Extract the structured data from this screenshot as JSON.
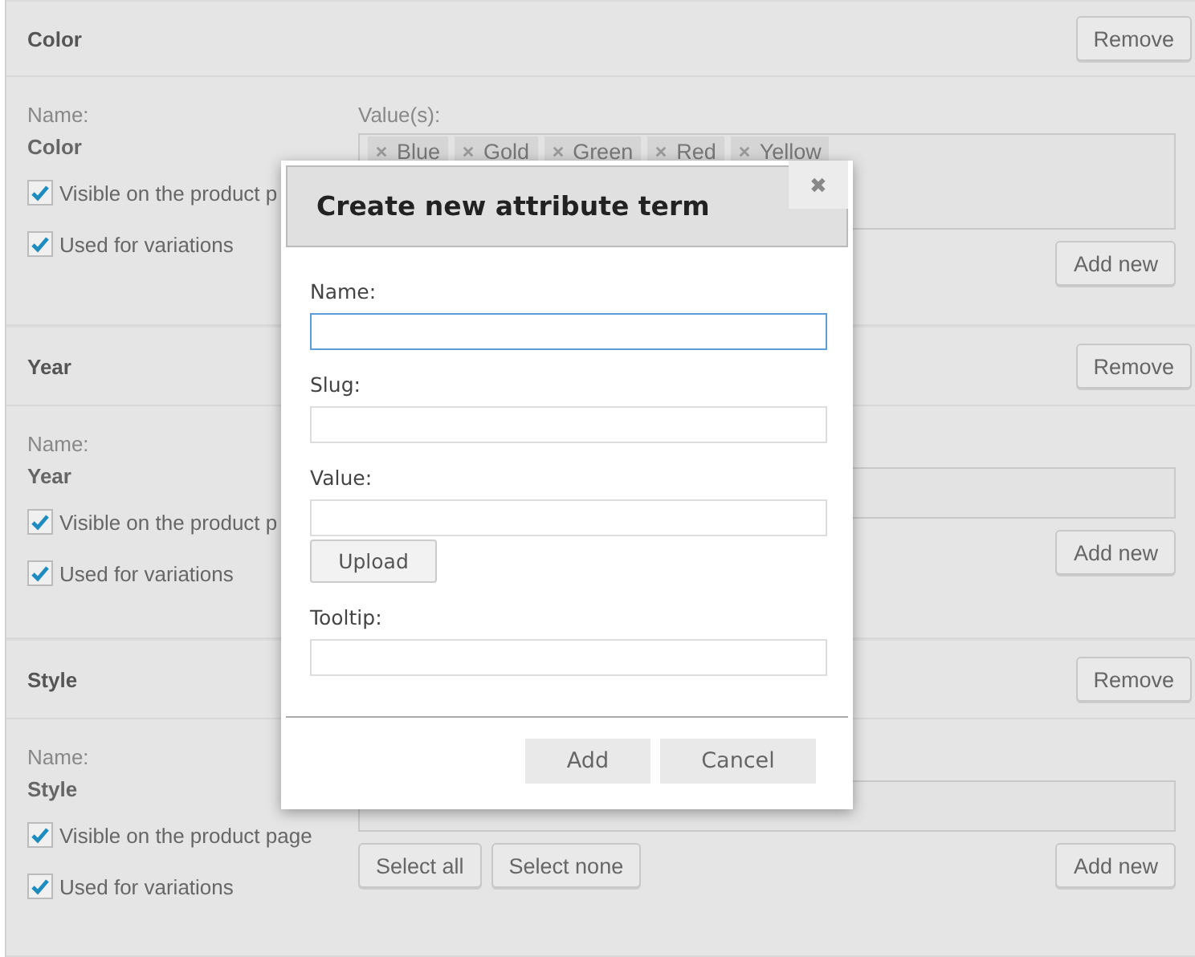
{
  "attributes": [
    {
      "title": "Color",
      "remove_button": "Remove",
      "name_label": "Name:",
      "name": "Color",
      "values_label": "Value(s):",
      "values": [
        {
          "label": "Blue"
        },
        {
          "label": "Gold"
        },
        {
          "label": "Green"
        },
        {
          "label": "Red"
        },
        {
          "label": "Yellow"
        }
      ],
      "options": [
        {
          "label": "Visible on the product p",
          "checked": true
        },
        {
          "label": "Used for variations",
          "checked": true
        }
      ],
      "buttons": [
        {
          "label": "Add new",
          "kind": "add"
        }
      ]
    },
    {
      "title": "Year",
      "remove_button": "Remove",
      "name_label": "Name:",
      "name": "Year",
      "options": [
        {
          "label": "Visible on the product p",
          "checked": true
        },
        {
          "label": "Used for variations",
          "checked": true
        }
      ],
      "buttons": [
        {
          "label": "Add new",
          "kind": "add"
        }
      ]
    },
    {
      "title": "Style",
      "remove_button": "Remove",
      "name_label": "Name:",
      "name": "Style",
      "options": [
        {
          "label": "Visible on the product page",
          "checked": true
        },
        {
          "label": "Used for variations",
          "checked": true
        }
      ],
      "buttons": [
        {
          "label": "Select all",
          "kind": "bulk"
        },
        {
          "label": "Select none",
          "kind": "bulk"
        },
        {
          "label": "Add new",
          "kind": "add"
        }
      ]
    }
  ],
  "dialog": {
    "title": "Create new attribute term",
    "close": "✖",
    "fields": [
      {
        "label": "Name:",
        "focused": true
      },
      {
        "label": "Slug:",
        "focused": false
      },
      {
        "label": "Value:",
        "focused": false,
        "button": "Upload"
      },
      {
        "label": "Tooltip:",
        "focused": false
      }
    ],
    "buttons": [
      "Add",
      "Cancel"
    ]
  }
}
